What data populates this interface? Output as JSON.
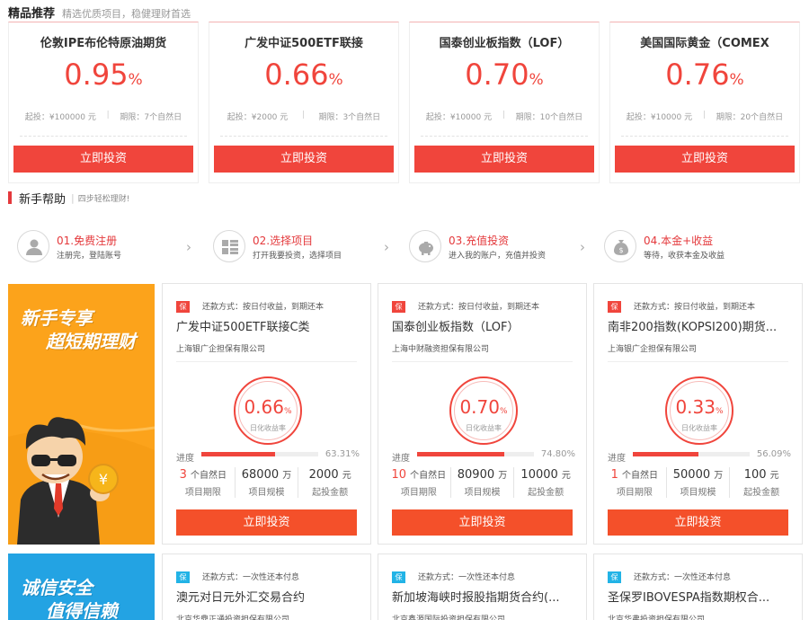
{
  "featured": {
    "title": "精品推荐",
    "subtitle": "精选优质项目，稳健理财首选",
    "products": [
      {
        "name": "伦敦IPE布伦特原油期货",
        "rate": "0.95",
        "unit": "%",
        "min_invest": "起投：¥100000 元",
        "period": "期限：7个自然日",
        "button": "立即投资"
      },
      {
        "name": "广发中证500ETF联接",
        "rate": "0.66",
        "unit": "%",
        "min_invest": "起投：¥2000 元",
        "period": "期限：3个自然日",
        "button": "立即投资"
      },
      {
        "name": "国泰创业板指数（LOF）",
        "rate": "0.70",
        "unit": "%",
        "min_invest": "起投：¥10000 元",
        "period": "期限：10个自然日",
        "button": "立即投资"
      },
      {
        "name": "美国国际黄金（COMEX",
        "rate": "0.76",
        "unit": "%",
        "min_invest": "起投：¥10000 元",
        "period": "期限：20个自然日",
        "button": "立即投资"
      }
    ]
  },
  "help": {
    "title": "新手帮助",
    "divider": "|",
    "subtitle": "四步轻松理财!",
    "steps": [
      {
        "title": "01.免费注册",
        "desc": "注册完，登陆账号",
        "icon": "user-icon"
      },
      {
        "title": "02.选择项目",
        "desc": "打开我要投资，选择项目",
        "icon": "grid-list-icon"
      },
      {
        "title": "03.充值投资",
        "desc": "进入我的账户，充值并投资",
        "icon": "piggy-bank-icon"
      },
      {
        "title": "04.本金+收益",
        "desc": "等待，收获本金及收益",
        "icon": "money-bag-icon"
      }
    ],
    "arrow": "›"
  },
  "promo1": {
    "line1": "新手专享",
    "line2": "超短期理财",
    "coin": "¥"
  },
  "promo2": {
    "line1": "诚信安全",
    "line2": "值得信赖"
  },
  "cards": [
    {
      "badge": "保",
      "repay": "还款方式：按日付收益，到期还本",
      "name": "广发中证500ETF联接C类",
      "guarantor": "上海银广企担保有限公司",
      "rate": "0.66",
      "unit": "%",
      "rate_label": "日化收益率",
      "progress_label": "进度",
      "progress": 63.31,
      "progress_text": "63.31%",
      "period_value": "3",
      "period_unit": "个自然日",
      "period_label": "项目期限",
      "scale_value": "68000",
      "scale_unit": "万",
      "scale_label": "项目规模",
      "min_value": "2000",
      "min_unit": "元",
      "min_label": "起投金额",
      "button": "立即投资"
    },
    {
      "badge": "保",
      "repay": "还款方式：按日付收益，到期还本",
      "name": "国泰创业板指数（LOF）",
      "guarantor": "上海中财融资担保有限公司",
      "rate": "0.70",
      "unit": "%",
      "rate_label": "日化收益率",
      "progress_label": "进度",
      "progress": 74.8,
      "progress_text": "74.80%",
      "period_value": "10",
      "period_unit": "个自然日",
      "period_label": "项目期限",
      "scale_value": "80900",
      "scale_unit": "万",
      "scale_label": "项目规模",
      "min_value": "10000",
      "min_unit": "元",
      "min_label": "起投金额",
      "button": "立即投资"
    },
    {
      "badge": "保",
      "repay": "还款方式：按日付收益，到期还本",
      "name": "南非200指数(KOPSI200)期货...",
      "guarantor": "上海银广企担保有限公司",
      "rate": "0.33",
      "unit": "%",
      "rate_label": "日化收益率",
      "progress_label": "进度",
      "progress": 56.09,
      "progress_text": "56.09%",
      "period_value": "1",
      "period_unit": "个自然日",
      "period_label": "项目期限",
      "scale_value": "50000",
      "scale_unit": "万",
      "scale_label": "项目规模",
      "min_value": "100",
      "min_unit": "元",
      "min_label": "起投金额",
      "button": "立即投资"
    }
  ],
  "cards_row2": [
    {
      "badge": "保",
      "repay": "还款方式：一次性还本付息",
      "name": "澳元对日元外汇交易合约",
      "guarantor": "北京华鼎正通投资担保有限公司"
    },
    {
      "badge": "保",
      "repay": "还款方式：一次性还本付息",
      "name": "新加坡海峡时报股指期货合约(...",
      "guarantor": "北京鑫源国际投资担保有限公司"
    },
    {
      "badge": "保",
      "repay": "还款方式：一次性还本付息",
      "name": "圣保罗IBOVESPA指数期权合...",
      "guarantor": "北京华弗投资担保有限公司"
    }
  ]
}
